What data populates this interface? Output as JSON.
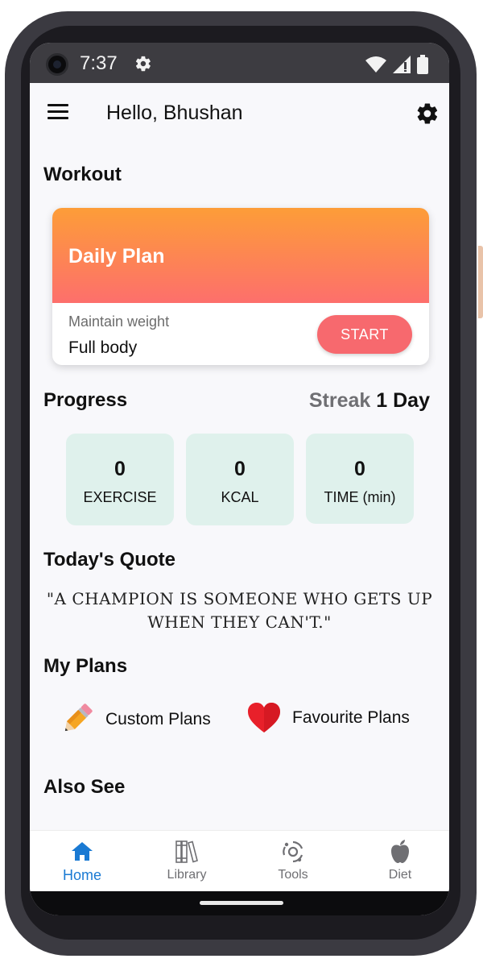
{
  "status_bar": {
    "time": "7:37",
    "icons": [
      "gear-icon",
      "wifi-icon",
      "signal-icon",
      "battery-icon"
    ]
  },
  "header": {
    "greeting": "Hello, Bhushan",
    "menu_icon": "menu-icon",
    "settings_icon": "settings-icon"
  },
  "workout": {
    "section_title": "Workout",
    "card": {
      "title": "Daily Plan",
      "goal": "Maintain weight",
      "focus": "Full body",
      "start_label": "START"
    }
  },
  "progress": {
    "section_title": "Progress",
    "streak_label": "Streak",
    "streak_value": "1 Day",
    "stats": [
      {
        "value": "0",
        "label": "EXERCISE"
      },
      {
        "value": "0",
        "label": "KCAL"
      },
      {
        "value": "0",
        "label": "TIME (min)"
      }
    ]
  },
  "quote": {
    "section_title": "Today's Quote",
    "text": "\"A CHAMPION IS SOMEONE WHO GETS UP WHEN THEY CAN'T.\""
  },
  "my_plans": {
    "section_title": "My Plans",
    "items": [
      {
        "label": "Custom Plans",
        "icon": "pencil-icon"
      },
      {
        "label": "Favourite Plans",
        "icon": "heart-icon"
      }
    ]
  },
  "also_see": {
    "section_title": "Also See"
  },
  "bottom_nav": {
    "items": [
      {
        "label": "Home",
        "icon": "home-icon",
        "active": true
      },
      {
        "label": "Library",
        "icon": "library-icon",
        "active": false
      },
      {
        "label": "Tools",
        "icon": "tools-icon",
        "active": false
      },
      {
        "label": "Diet",
        "icon": "apple-icon",
        "active": false
      }
    ]
  },
  "colors": {
    "accent_blue": "#1a7ad3",
    "gradient_top": "#fd9d38",
    "gradient_bottom": "#fd6f6c",
    "start_button": "#f7696e",
    "stat_background": "#dff1ec"
  }
}
